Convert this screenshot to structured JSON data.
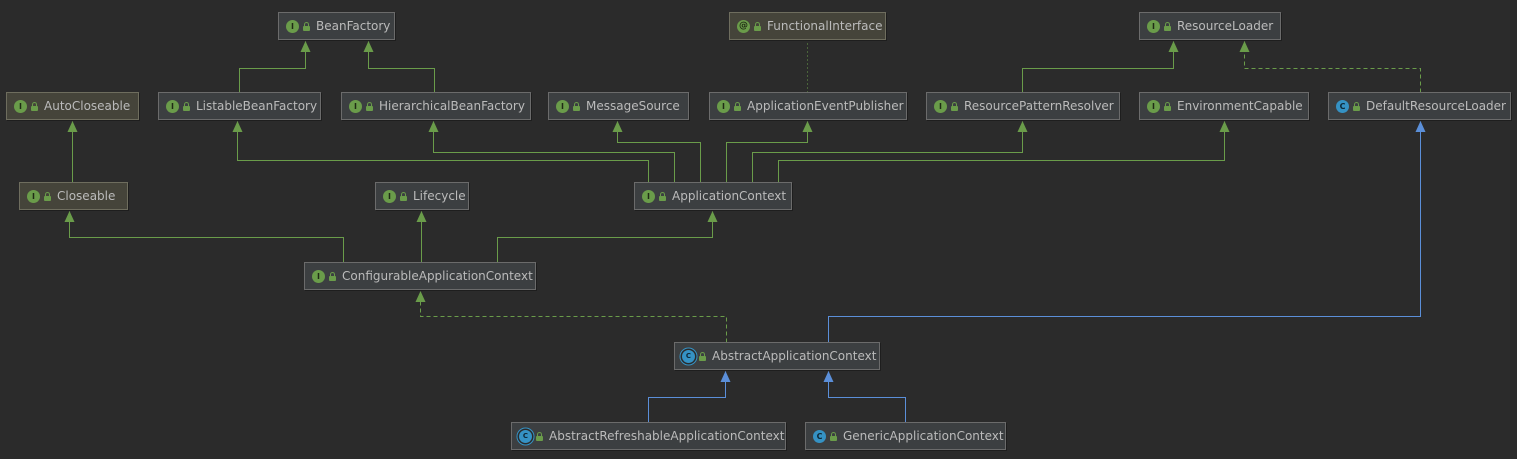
{
  "nodes": {
    "beanfactory": {
      "label": "BeanFactory",
      "kind": "interface",
      "badge": "I"
    },
    "functionalinterface": {
      "label": "FunctionalInterface",
      "kind": "annotation",
      "badge": "@"
    },
    "resourceloader": {
      "label": "ResourceLoader",
      "kind": "interface",
      "badge": "I"
    },
    "autocloseable": {
      "label": "AutoCloseable",
      "kind": "interface",
      "badge": "I"
    },
    "listablebeanfactory": {
      "label": "ListableBeanFactory",
      "kind": "interface",
      "badge": "I"
    },
    "hierarchicalbeanfactory": {
      "label": "HierarchicalBeanFactory",
      "kind": "interface",
      "badge": "I"
    },
    "messagesource": {
      "label": "MessageSource",
      "kind": "interface",
      "badge": "I"
    },
    "applicationeventpublisher": {
      "label": "ApplicationEventPublisher",
      "kind": "interface",
      "badge": "I"
    },
    "resourcepatternresolver": {
      "label": "ResourcePatternResolver",
      "kind": "interface",
      "badge": "I"
    },
    "environmentcapable": {
      "label": "EnvironmentCapable",
      "kind": "interface",
      "badge": "I"
    },
    "defaultresourceloader": {
      "label": "DefaultResourceLoader",
      "kind": "class",
      "badge": "C"
    },
    "closeable": {
      "label": "Closeable",
      "kind": "interface",
      "badge": "I"
    },
    "lifecycle": {
      "label": "Lifecycle",
      "kind": "interface",
      "badge": "I"
    },
    "applicationcontext": {
      "label": "ApplicationContext",
      "kind": "interface",
      "badge": "I"
    },
    "configurableapplicationcontext": {
      "label": "ConfigurableApplicationContext",
      "kind": "interface",
      "badge": "I"
    },
    "abstractapplicationcontext": {
      "label": "AbstractApplicationContext",
      "kind": "abstract-class",
      "badge": "C"
    },
    "abstractrefreshableapplicationcontext": {
      "label": "AbstractRefreshableApplicationContext",
      "kind": "abstract-class",
      "badge": "C"
    },
    "genericapplicationcontext": {
      "label": "GenericApplicationContext",
      "kind": "class",
      "badge": "C"
    }
  },
  "edges": [
    {
      "from": "listablebeanfactory",
      "to": "beanfactory",
      "type": "extends"
    },
    {
      "from": "hierarchicalbeanfactory",
      "to": "beanfactory",
      "type": "extends"
    },
    {
      "from": "applicationeventpublisher",
      "to": "functionalinterface",
      "type": "annotated"
    },
    {
      "from": "resourcepatternresolver",
      "to": "resourceloader",
      "type": "extends"
    },
    {
      "from": "defaultresourceloader",
      "to": "resourceloader",
      "type": "implements"
    },
    {
      "from": "closeable",
      "to": "autocloseable",
      "type": "extends"
    },
    {
      "from": "applicationcontext",
      "to": "listablebeanfactory",
      "type": "extends"
    },
    {
      "from": "applicationcontext",
      "to": "hierarchicalbeanfactory",
      "type": "extends"
    },
    {
      "from": "applicationcontext",
      "to": "messagesource",
      "type": "extends"
    },
    {
      "from": "applicationcontext",
      "to": "applicationeventpublisher",
      "type": "extends"
    },
    {
      "from": "applicationcontext",
      "to": "resourcepatternresolver",
      "type": "extends"
    },
    {
      "from": "applicationcontext",
      "to": "environmentcapable",
      "type": "extends"
    },
    {
      "from": "configurableapplicationcontext",
      "to": "closeable",
      "type": "extends"
    },
    {
      "from": "configurableapplicationcontext",
      "to": "lifecycle",
      "type": "extends"
    },
    {
      "from": "configurableapplicationcontext",
      "to": "applicationcontext",
      "type": "extends"
    },
    {
      "from": "abstractapplicationcontext",
      "to": "configurableapplicationcontext",
      "type": "implements"
    },
    {
      "from": "abstractapplicationcontext",
      "to": "defaultresourceloader",
      "type": "class-extends"
    },
    {
      "from": "abstractrefreshableapplicationcontext",
      "to": "abstractapplicationcontext",
      "type": "class-extends"
    },
    {
      "from": "genericapplicationcontext",
      "to": "abstractapplicationcontext",
      "type": "class-extends"
    }
  ],
  "colors": {
    "background": "#2b2b2b",
    "interface_edge": "#6a9c4a",
    "class_edge": "#5b8fd9",
    "node_text": "#bbbbbb"
  }
}
